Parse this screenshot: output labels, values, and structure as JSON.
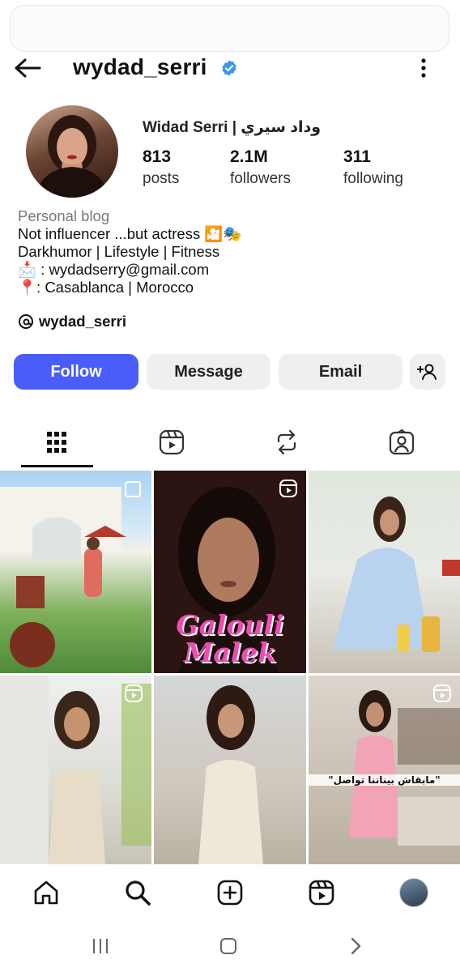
{
  "header": {
    "username": "wydad_serri",
    "verified_icon": "verified-badge-icon",
    "back_icon": "arrow-left-icon",
    "more_icon": "more-vertical-icon"
  },
  "profile": {
    "full_name": "Widad Serri | وداد سيري",
    "stats": [
      {
        "value": "813",
        "label": "posts"
      },
      {
        "value": "2.1M",
        "label": "followers"
      },
      {
        "value": "311",
        "label": "following"
      }
    ]
  },
  "bio": {
    "category": "Personal blog",
    "line1": "Not influencer ...but actress 🎦🎭",
    "line2": "Darkhumor | Lifestyle | Fitness",
    "line3": "📩 : wydadserry@gmail.com",
    "line4": "📍: Casablanca | Morocco",
    "threads_handle": "wydad_serri"
  },
  "actions": {
    "follow": "Follow",
    "message": "Message",
    "email": "Email",
    "add_user_icon": "person-add-icon"
  },
  "tabs": [
    "grid-icon",
    "reels-icon",
    "reposts-icon",
    "tagged-icon"
  ],
  "grid": {
    "post_overlay_text": "Galouli Malek",
    "post_caption": "\"مابقاش بيناتنا تواصل\""
  },
  "bottom_nav": [
    "home-icon",
    "search-icon",
    "create-icon",
    "reels-icon",
    "profile-avatar"
  ],
  "colors": {
    "accent": "#4a5df9",
    "verified": "#3897f0",
    "button_bg": "#efeff1"
  }
}
